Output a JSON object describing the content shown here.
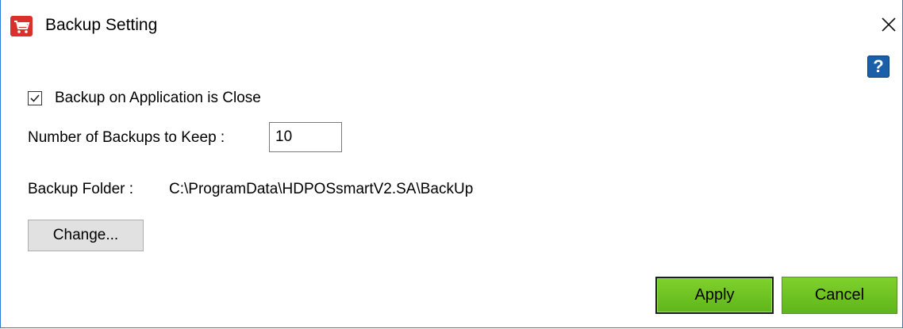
{
  "window": {
    "title": "Backup Setting",
    "app_icon": "shopping-cart-icon",
    "close_icon": "close-icon",
    "help_icon": "help-icon",
    "help_glyph": "?"
  },
  "backup_on_close": {
    "label": "Backup on Application is Close",
    "checked": true
  },
  "backups_to_keep": {
    "label": "Number of Backups  to Keep :",
    "value": "10"
  },
  "backup_folder": {
    "label": "Backup Folder :",
    "path": "C:\\ProgramData\\HDPOSsmartV2.SA\\BackUp"
  },
  "buttons": {
    "change": "Change...",
    "apply": "Apply",
    "cancel": "Cancel"
  },
  "colors": {
    "accent_green": "#6cc123",
    "help_blue": "#1a5fa8",
    "window_border": "#2b79d7",
    "icon_red": "#d9302b"
  }
}
